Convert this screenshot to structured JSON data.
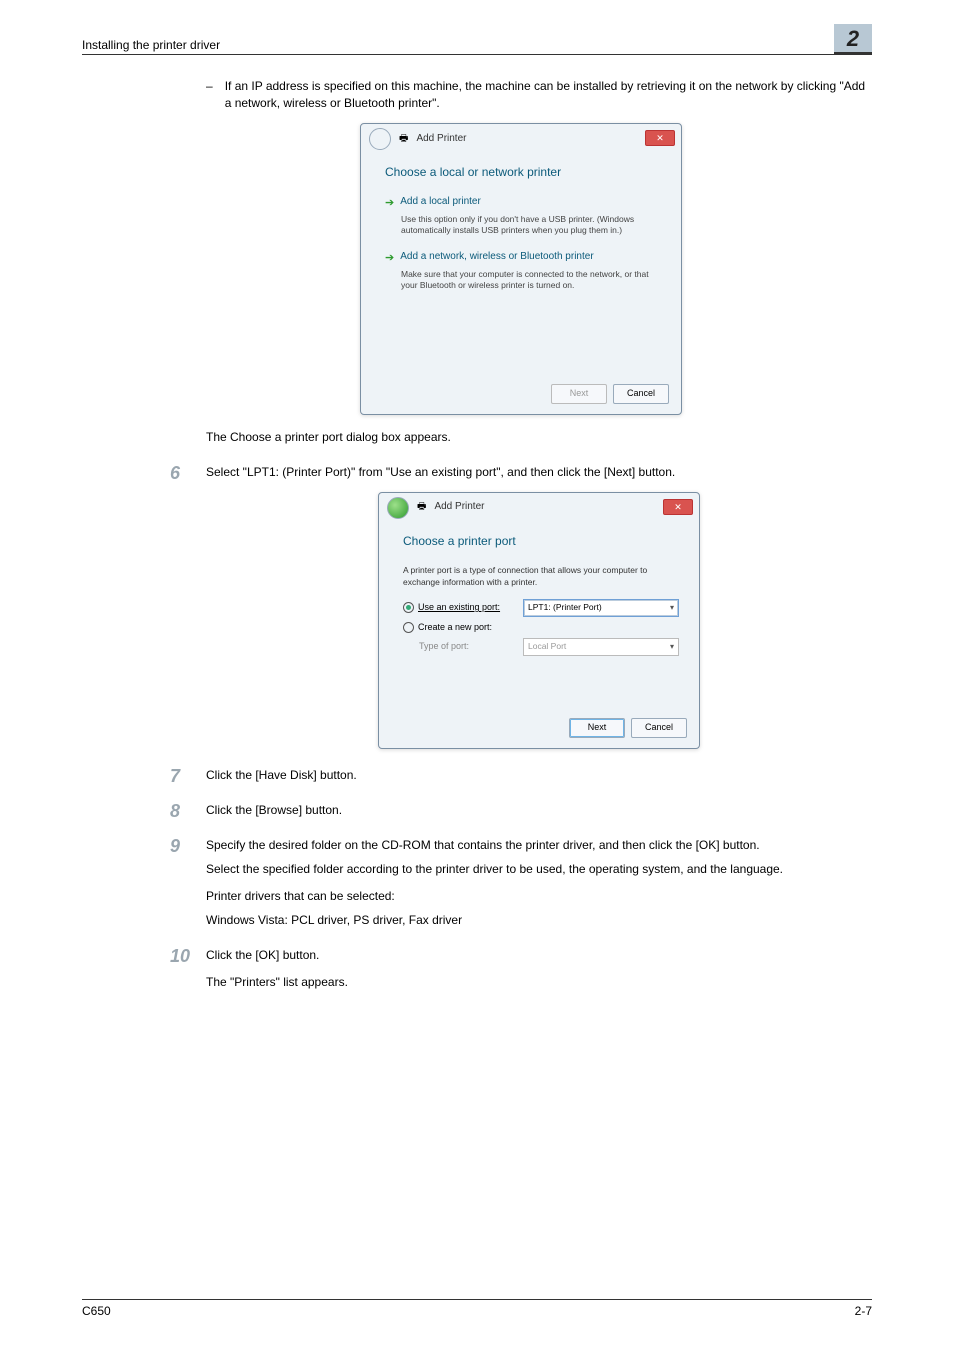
{
  "header": {
    "section": "Installing the printer driver",
    "chapter": "2"
  },
  "intro_bullet": "If an IP address is specified on this machine, the machine can be installed by retrieving it on the network by clicking \"Add a network, wireless or Bluetooth printer\".",
  "dlg1": {
    "title": "Add Printer",
    "heading": "Choose a local or network printer",
    "opt1_t": "Add a local printer",
    "opt1_d": "Use this option only if you don't have a USB printer. (Windows automatically installs USB printers when you plug them in.)",
    "opt2_t": "Add a network, wireless or Bluetooth printer",
    "opt2_d": "Make sure that your computer is connected to the network, or that your Bluetooth or wireless printer is turned on.",
    "next": "Next",
    "cancel": "Cancel"
  },
  "after_dlg1": "The Choose a printer port dialog box appears.",
  "step6": "Select \"LPT1: (Printer Port)\" from \"Use an existing port\", and then click the [Next] button.",
  "dlg2": {
    "title": "Add Printer",
    "heading": "Choose a printer port",
    "desc": "A printer port is a type of connection that allows your computer to exchange information with a printer.",
    "use_existing": "Use an existing port:",
    "existing_value": "LPT1: (Printer Port)",
    "create": "Create a new port:",
    "type_of_port": "Type of port:",
    "type_value": "Local Port",
    "next": "Next",
    "cancel": "Cancel"
  },
  "step7": "Click the [Have Disk] button.",
  "step8": "Click the [Browse] button.",
  "step9_a": "Specify the desired folder on the CD-ROM that contains the printer driver, and then click the [OK] button.",
  "step9_b": "Select the specified folder according to the printer driver to be used, the operating system, and the language.",
  "step9_c": "Printer drivers that can be selected:",
  "step9_d": "Windows Vista: PCL driver, PS driver, Fax driver",
  "step10_a": "Click the [OK] button.",
  "step10_b": "The \"Printers\" list appears.",
  "footer": {
    "model": "C650",
    "page": "2-7"
  },
  "nums": {
    "s6": "6",
    "s7": "7",
    "s8": "8",
    "s9": "9",
    "s10": "10"
  }
}
